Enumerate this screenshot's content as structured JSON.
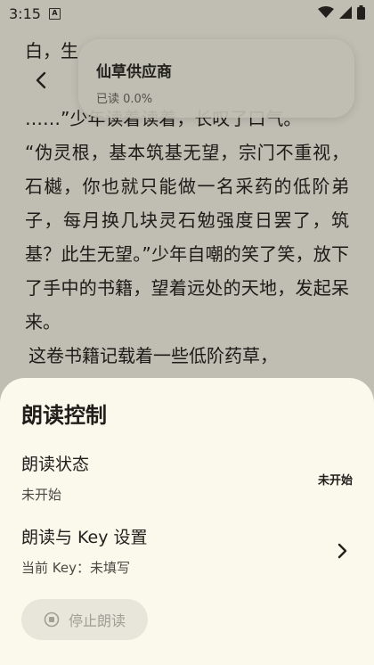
{
  "status_bar": {
    "time": "3:15",
    "app_indicator": "A"
  },
  "reader": {
    "lines": [
      "白，生",
      "……”少年读着读着，长叹了口气。",
      "“伪灵根，基本筑基无望，宗门不重视，石樾，你也就只能做一名采药的低阶弟子，每月换几块灵石勉强度日罢了，筑基？此生无望。”少年自嘲的笑了笑，放下了手中的书籍，望着远处的天地，发起呆来。",
      "这卷书籍记载着一些低阶药草，"
    ]
  },
  "header": {
    "book_title": "仙草供应商",
    "progress_text": "已读 0.0%"
  },
  "sheet": {
    "title": "朗读控制",
    "status_row": {
      "title": "朗读状态",
      "subtitle": "未开始",
      "value": "未开始"
    },
    "settings_row": {
      "title": "朗读与 Key 设置",
      "subtitle": "当前 Key：未填写"
    },
    "stop_button": {
      "label": "停止朗读"
    }
  },
  "colors": {
    "page_bg": "#f6f2e4",
    "sheet_bg": "#fbf8ec",
    "text": "#26241f",
    "disabled_text": "#a09e95"
  }
}
